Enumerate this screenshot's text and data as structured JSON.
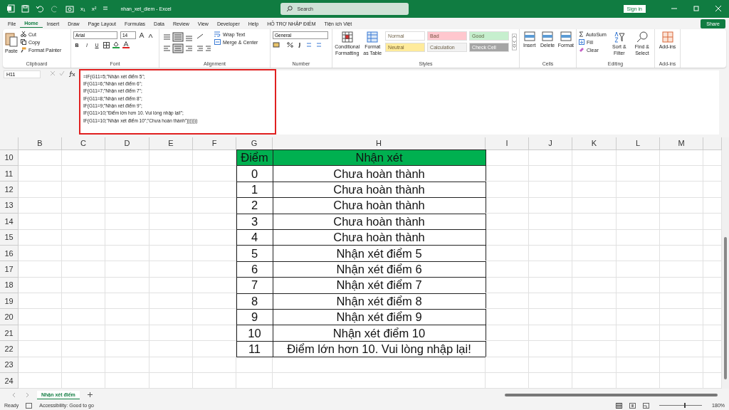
{
  "title_bar": {
    "quick_access": [
      "x₁",
      "x²"
    ],
    "title": "nhan_xet_diem  -  Excel",
    "search": {
      "placeholder": "Search"
    },
    "sign_in": "Sign in"
  },
  "menu": [
    {
      "label": "File",
      "selected": false
    },
    {
      "label": "Home",
      "selected": true
    },
    {
      "label": "Insert",
      "selected": false
    },
    {
      "label": "Draw",
      "selected": false
    },
    {
      "label": "Page Layout",
      "selected": false
    },
    {
      "label": "Formulas",
      "selected": false
    },
    {
      "label": "Data",
      "selected": false
    },
    {
      "label": "Review",
      "selected": false
    },
    {
      "label": "View",
      "selected": false
    },
    {
      "label": "Developer",
      "selected": false
    },
    {
      "label": "Help",
      "selected": false
    },
    {
      "label": "HỖ TRỢ NHẬP ĐIỂM",
      "selected": false
    },
    {
      "label": "Tiện ích Việt",
      "selected": false
    }
  ],
  "share": "Share",
  "ribbon": {
    "clipboard": {
      "paste": "Paste",
      "cut": "Cut",
      "copy": "Copy",
      "format_painter": "Format Painter",
      "label": "Clipboard"
    },
    "font": {
      "name": "Arial",
      "size": "14",
      "format_buttons": [
        "B",
        "I",
        "U"
      ],
      "label": "Font"
    },
    "alignment": {
      "wrap_text": "Wrap Text",
      "merge": "Merge & Center",
      "label": "Alignment"
    },
    "number": {
      "format": "General",
      "label": "Number"
    },
    "styles": {
      "conditional": "Conditional Formatting",
      "format_as_table": "Format as Table",
      "label": "Styles",
      "cells": [
        {
          "label": "Normal",
          "color": "#ffffff"
        },
        {
          "label": "Bad",
          "color": "#ffc7ce"
        },
        {
          "label": "Good",
          "color": "#c6efce"
        },
        {
          "label": "Neutral",
          "color": "#ffeb9c"
        },
        {
          "label": "Calculation",
          "color": "#f2f2f2"
        },
        {
          "label": "Check Cell",
          "color": "#a5a5a5"
        }
      ]
    },
    "cells": {
      "buttons": [
        "Insert",
        "Delete",
        "Format"
      ],
      "label": "Cells"
    },
    "editing": {
      "autosum": "AutoSum",
      "fill": "Fill",
      "clear": "Clear",
      "sort": "Sort & Filter",
      "find": "Find & Select",
      "label": "Editing"
    },
    "addins": {
      "button": "Add-ins",
      "label": "Add-ins"
    }
  },
  "formula_bar": {
    "name_box": "H11",
    "formula": [
      "=IF(G11=5;\"Nhận xét điểm 5\";",
      "IF(G11=6;\"Nhận xét điểm 6\";",
      "IF(G11=7;\"Nhận xét điểm 7\";",
      "IF(G11=8;\"Nhận xét điểm 8\";",
      "IF(G11=9;\"Nhận xét điểm 9\";",
      "IF(G11>10;\"Điểm lớn hơn 10. Vui lòng nhập lại!\";",
      "IF(G11=10;\"Nhận xét điểm 10\";\"Chưa hoàn thành\")))))))"
    ]
  },
  "sheet": {
    "columns": [
      "B",
      "C",
      "D",
      "E",
      "F",
      "G",
      "H",
      "I",
      "J",
      "K",
      "L",
      "M"
    ],
    "rows": [
      {
        "number": "10",
        "kind": "header",
        "cells": [
          "Điểm",
          "Nhận xét"
        ]
      },
      {
        "number": "11",
        "kind": "data",
        "cells": [
          "0",
          "Chưa hoàn thành"
        ]
      },
      {
        "number": "12",
        "kind": "data",
        "cells": [
          "1",
          "Chưa hoàn thành"
        ]
      },
      {
        "number": "13",
        "kind": "data",
        "cells": [
          "2",
          "Chưa hoàn thành"
        ]
      },
      {
        "number": "14",
        "kind": "data",
        "cells": [
          "3",
          "Chưa hoàn thành"
        ]
      },
      {
        "number": "15",
        "kind": "data",
        "cells": [
          "4",
          "Chưa hoàn thành"
        ]
      },
      {
        "number": "16",
        "kind": "data",
        "cells": [
          "5",
          "Nhận xét điểm 5"
        ]
      },
      {
        "number": "17",
        "kind": "data",
        "cells": [
          "6",
          "Nhận xét điểm 6"
        ]
      },
      {
        "number": "18",
        "kind": "data",
        "cells": [
          "7",
          "Nhận xét điểm 7"
        ]
      },
      {
        "number": "19",
        "kind": "data",
        "cells": [
          "8",
          "Nhận xét điểm 8"
        ]
      },
      {
        "number": "20",
        "kind": "data",
        "cells": [
          "9",
          "Nhận xét điểm 9"
        ]
      },
      {
        "number": "21",
        "kind": "data",
        "cells": [
          "10",
          "Nhận xét điểm 10"
        ]
      },
      {
        "number": "22",
        "kind": "data",
        "cells": [
          "11",
          "Điểm lớn hơn 10. Vui lòng nhập lại!"
        ]
      },
      {
        "number": "23",
        "kind": "empty"
      },
      {
        "number": "24",
        "kind": "empty"
      }
    ]
  },
  "sheet_tabs": [
    {
      "label": "Nhận xét điểm",
      "selected": true
    }
  ],
  "status_bar": {
    "ready": "Ready",
    "accessibility": "Accessibility: Good to go",
    "zoom": "180%",
    "zoom_slider": {
      "level": 0.58
    }
  }
}
